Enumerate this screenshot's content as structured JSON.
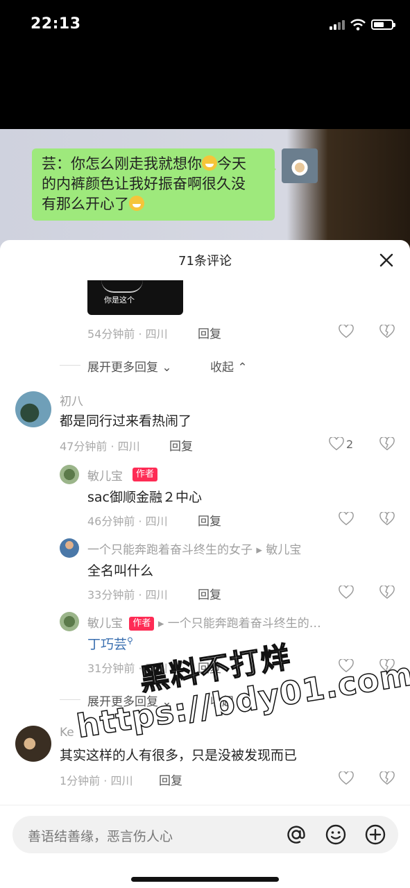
{
  "status_bar": {
    "time": "22:13",
    "battery_level": 0.6
  },
  "photo": {
    "bubble_line1": "芸：你怎么刚走我就想你",
    "bubble_line1_after": "今天",
    "bubble_line2": "的内裤颜色让我好振奋啊很久没",
    "bubble_line3": "有那么开心了",
    "emojis": [
      "laughing-crying-emoji",
      "grin-emoji"
    ]
  },
  "sheet": {
    "title": "71条评论"
  },
  "comments": {
    "top_reply": {
      "image_caption": "你是这个",
      "meta": "54分钟前 · 四川",
      "reply": "回复"
    },
    "expand1": {
      "more": "展开更多回复",
      "collapse": "收起"
    },
    "c1": {
      "name": "初八",
      "text": "都是同行过来看热闹了",
      "meta": "47分钟前 · 四川",
      "reply": "回复",
      "likes": "2"
    },
    "r1": {
      "name": "敏儿宝",
      "tag": "作者",
      "text": "sac御顺金融２中心",
      "meta": "46分钟前 · 四川",
      "reply": "回复"
    },
    "r2": {
      "name": "一个只能奔跑着奋斗终生的女子",
      "arrow": "▸",
      "target": "敏儿宝",
      "text": "全名叫什么",
      "meta": "33分钟前 · 四川",
      "reply": "回复"
    },
    "r3": {
      "name": "敏儿宝",
      "tag": "作者",
      "arrow": "▸",
      "target": "一个只能奔跑着奋斗终生的…",
      "text": "丁巧芸",
      "meta": "31分钟前 · 四川",
      "reply": "回复"
    },
    "expand2": {
      "more": "展开更多回复",
      "collapse": "收起"
    },
    "c2": {
      "name": "Ke",
      "text": "其实这样的人有很多，只是没被发现而已",
      "meta": "1分钟前 · 四川",
      "reply": "回复"
    }
  },
  "watermark": {
    "line1": "黑料不打烊",
    "line2": "https://bdy01.com"
  },
  "input": {
    "placeholder": "善语结善缘，恶言伤人心"
  },
  "colors": {
    "accent": "#fe2c55",
    "bubble": "#9ee97c",
    "link": "#3a6fb0"
  }
}
